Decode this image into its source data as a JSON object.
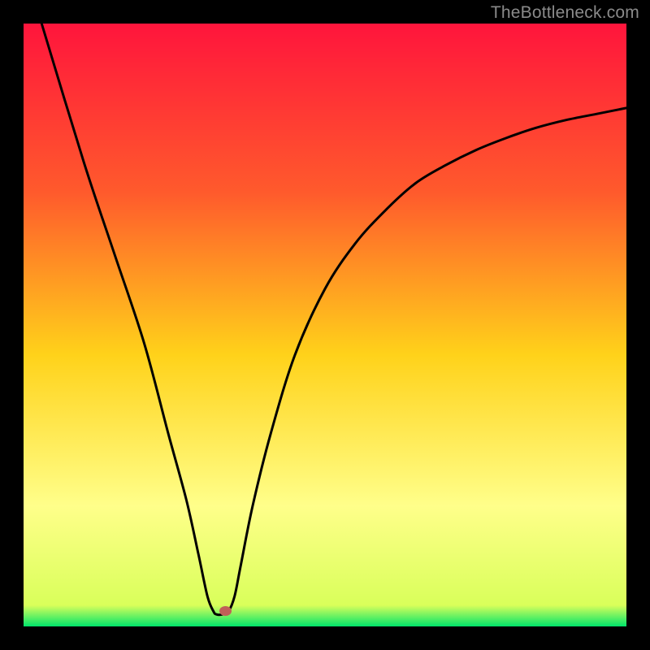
{
  "watermark": "TheBottleneck.com",
  "colors": {
    "top": "#ff153c",
    "upper_mid": "#ff6b2a",
    "mid": "#ffd21a",
    "lower_mid": "#ffff7d",
    "bottom": "#00e56a",
    "curve": "#000000",
    "frame": "#000000",
    "marker": "#c06058"
  },
  "chart_data": {
    "type": "line",
    "title": "",
    "xlabel": "",
    "ylabel": "",
    "xlim": [
      0,
      100
    ],
    "ylim": [
      0,
      100
    ],
    "series": [
      {
        "name": "curve",
        "x": [
          3,
          10,
          15,
          20,
          24,
          27,
          29,
          30.5,
          31.5,
          32,
          33,
          34,
          35,
          36,
          38,
          41,
          45,
          50,
          55,
          60,
          65,
          70,
          75,
          80,
          85,
          90,
          95,
          100
        ],
        "y": [
          100,
          77,
          62,
          47,
          32,
          21,
          12,
          5,
          2.5,
          2,
          2,
          2.5,
          5,
          10,
          20,
          32,
          45,
          56,
          63.5,
          69,
          73.5,
          76.5,
          79,
          81,
          82.7,
          84,
          85,
          86
        ]
      }
    ],
    "marker": {
      "x": 33.5,
      "y": 2.5
    },
    "gradient_stops": [
      {
        "pos": 0.0,
        "color": "#ff153c"
      },
      {
        "pos": 0.28,
        "color": "#ff5a2c"
      },
      {
        "pos": 0.55,
        "color": "#ffd21a"
      },
      {
        "pos": 0.8,
        "color": "#ffff8a"
      },
      {
        "pos": 0.965,
        "color": "#d9ff5a"
      },
      {
        "pos": 1.0,
        "color": "#00e56a"
      }
    ]
  }
}
